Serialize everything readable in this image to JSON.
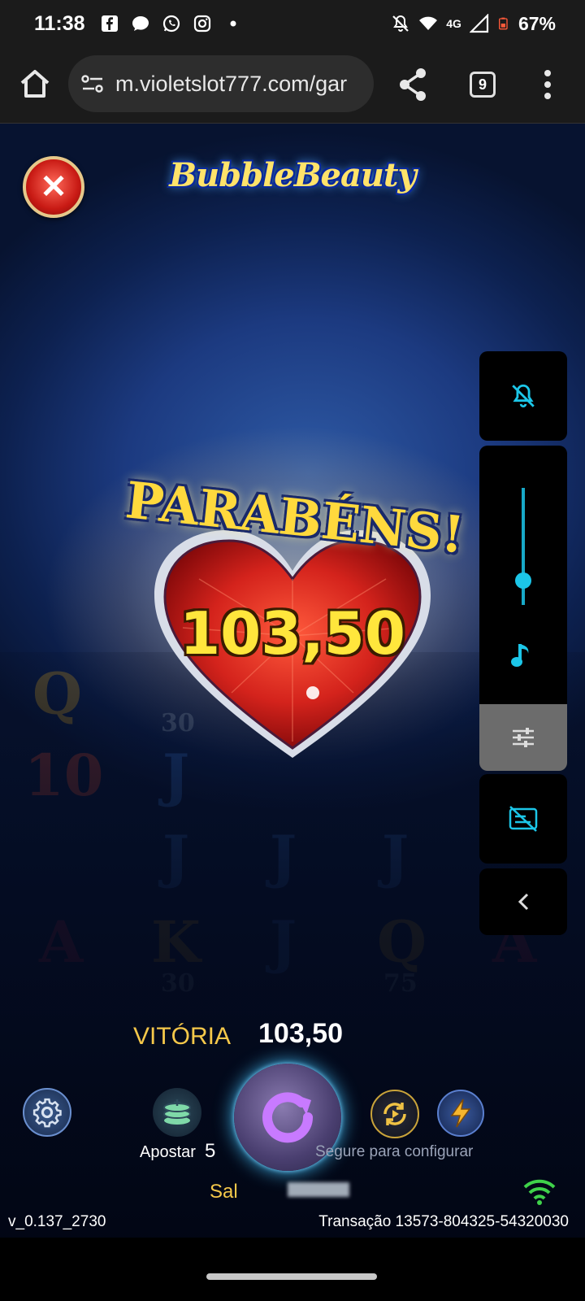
{
  "status_bar": {
    "time": "11:38",
    "network": "4G",
    "battery": "67%"
  },
  "browser": {
    "url": "m.violetslot777.com/gar",
    "tab_count": "9"
  },
  "game": {
    "logo": "BubbleBeauty",
    "congrats": "PARABÉNS!",
    "win_amount": "103,50",
    "vitoria_label": "VITÓRIA",
    "vitoria_value": "103,50",
    "apostar_label": "Apostar",
    "apostar_value": "5",
    "hold_hint": "Segure para configurar",
    "saldo_label": "Sal",
    "version": "v_0.137_2730",
    "transaction": "Transação 13573-804325-54320030"
  },
  "reel_symbols": [
    "Q",
    "10",
    "J",
    "J",
    "J",
    "J",
    "A",
    "K",
    "J",
    "Q",
    "A"
  ],
  "reel_badges": [
    "30",
    "30",
    "75"
  ],
  "colors": {
    "accent_cyan": "#1cc6e8",
    "gold": "#ffd93d",
    "heart_red": "#d4231c"
  },
  "side_icons": [
    "notifications-off-icon",
    "volume-slider",
    "music-note-icon",
    "equalizer-icon",
    "subtitles-off-icon",
    "chevron-left-icon"
  ]
}
